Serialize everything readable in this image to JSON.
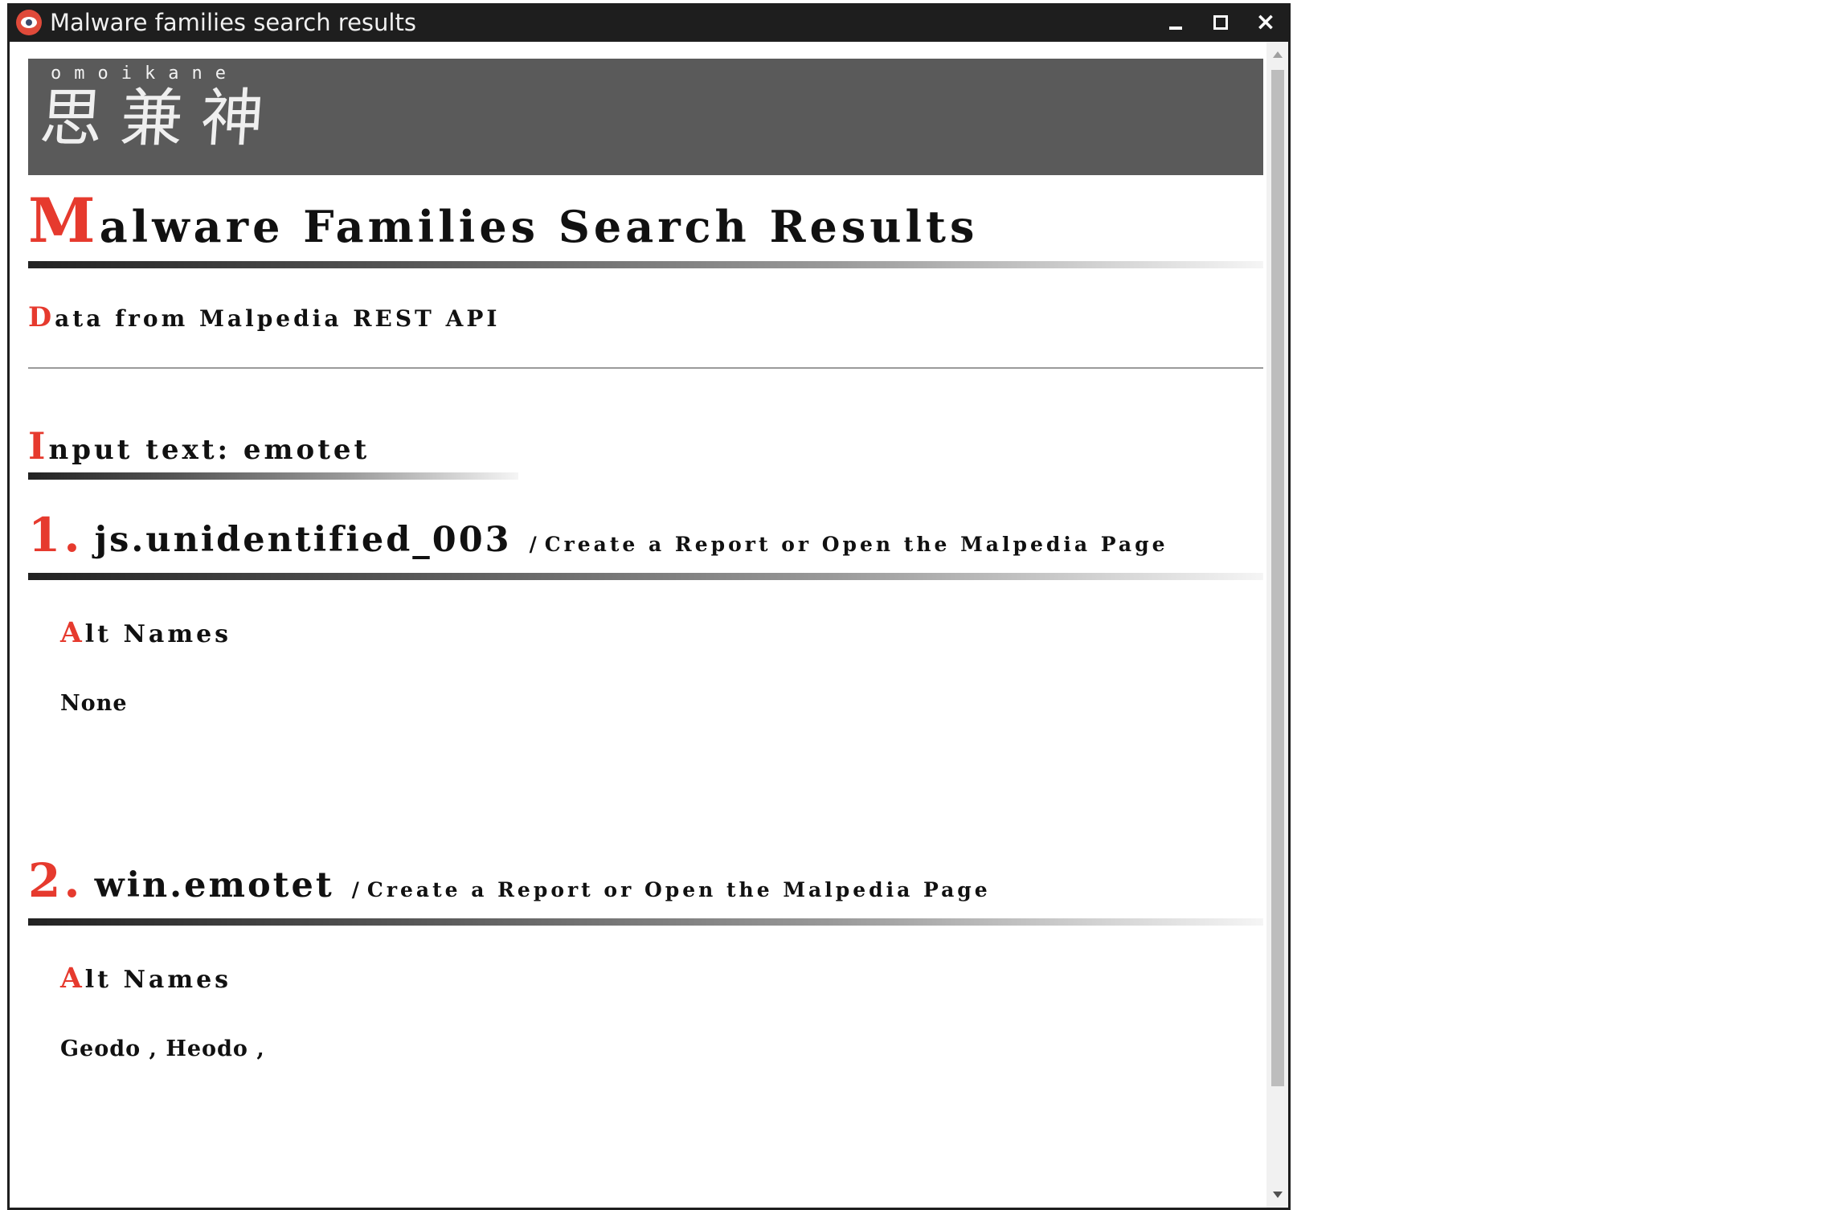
{
  "window": {
    "title": "Malware families search results",
    "controls": {
      "minimize": "minimize",
      "maximize": "maximize",
      "close": "×"
    }
  },
  "banner": {
    "romaji": "omoikane",
    "kanji": "思兼神"
  },
  "page": {
    "title_initial": "M",
    "title_rest": "alware Families Search Results",
    "subtitle_initial": "D",
    "subtitle_rest": "ata from Malpedia REST API",
    "input_initial": "I",
    "input_rest": "nput text: emotet"
  },
  "results": [
    {
      "number": "1.",
      "name": "js.unidentified_003",
      "separator": "/",
      "link_text": "Create a Report or Open the Malpedia Page",
      "alt_initial": "A",
      "alt_rest": "lt Names",
      "alt_values": "None"
    },
    {
      "number": "2.",
      "name": "win.emotet",
      "separator": "/",
      "link_text": "Create a Report or Open the Malpedia Page",
      "alt_initial": "A",
      "alt_rest": "lt Names",
      "alt_values": "Geodo , Heodo ,"
    }
  ],
  "colors": {
    "accent": "#e63a2e",
    "titlebar": "#1e1e1e",
    "banner": "#5a5a5a"
  }
}
